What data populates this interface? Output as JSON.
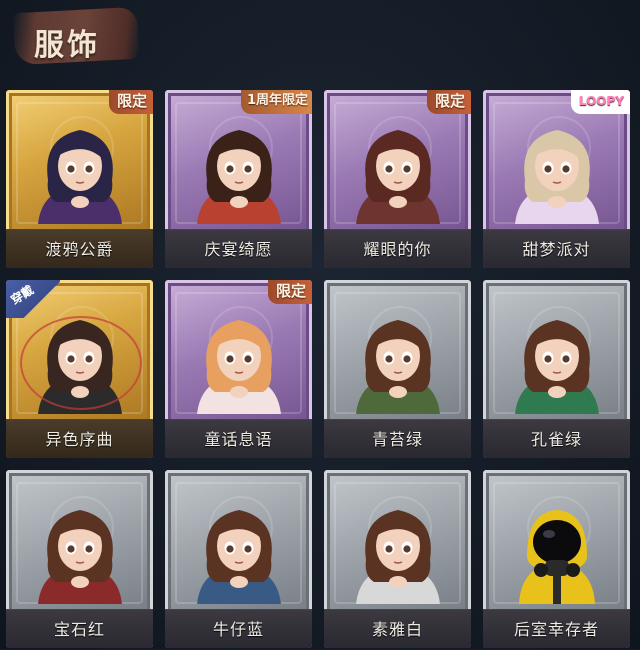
{
  "header": {
    "title": "服饰"
  },
  "costumes": [
    {
      "label": "渡鸦公爵",
      "tier": "gold",
      "badge": "限定",
      "badge_type": "limited",
      "figure": "raven-duke-figure",
      "hair": "#2a2446",
      "outfit": "#4a2f6b"
    },
    {
      "label": "庆宴绮愿",
      "tier": "purple",
      "badge": "1周年限定",
      "badge_type": "anniv",
      "figure": "cake-party-figure",
      "hair": "#3a2218",
      "outfit": "#b8412f"
    },
    {
      "label": "耀眼的你",
      "tier": "purple",
      "badge": "限定",
      "badge_type": "limited",
      "figure": "cowboy-hat-figure",
      "hair": "#5a2a22",
      "outfit": "#6e3430"
    },
    {
      "label": "甜梦派对",
      "tier": "purple",
      "badge": "LOOPY",
      "badge_type": "loopy",
      "figure": "sweet-dream-figure",
      "hair": "#d9c7a8",
      "outfit": "#e8d6ee"
    },
    {
      "label": "异色序曲",
      "tier": "gold",
      "badge": "",
      "badge_type": "none",
      "wear": "穿戴",
      "figure": "overture-figure",
      "hair": "#3a2620",
      "outfit": "#2b2b2b"
    },
    {
      "label": "童话息语",
      "tier": "purple",
      "badge": "限定",
      "badge_type": "limited",
      "figure": "fairytale-figure",
      "hair": "#e8a060",
      "outfit": "#f2e2e2"
    },
    {
      "label": "青苔绿",
      "tier": "grey",
      "badge": "",
      "badge_type": "none",
      "figure": "moss-green-figure",
      "hair": "#5a3322",
      "outfit": "#4f6a3a"
    },
    {
      "label": "孔雀绿",
      "tier": "grey",
      "badge": "",
      "badge_type": "none",
      "figure": "peacock-green-figure",
      "hair": "#5a3322",
      "outfit": "#2f7a4e"
    },
    {
      "label": "宝石红",
      "tier": "grey",
      "badge": "",
      "badge_type": "none",
      "figure": "ruby-red-figure",
      "hair": "#5a3322",
      "outfit": "#8a2a2a"
    },
    {
      "label": "牛仔蓝",
      "tier": "grey",
      "badge": "",
      "badge_type": "none",
      "figure": "denim-blue-figure",
      "hair": "#5a3322",
      "outfit": "#3a5a86"
    },
    {
      "label": "素雅白",
      "tier": "grey",
      "badge": "",
      "badge_type": "none",
      "figure": "plain-white-figure",
      "hair": "#5a3322",
      "outfit": "#d8d8d8"
    },
    {
      "label": "后室幸存者",
      "tier": "grey",
      "badge": "",
      "badge_type": "none",
      "figure": "backrooms-survivor-figure",
      "hair": "#111111",
      "outfit": "#e8c21a"
    }
  ],
  "colors": {
    "skin": "#f2d2bc",
    "eye": "#5a3a2a"
  }
}
